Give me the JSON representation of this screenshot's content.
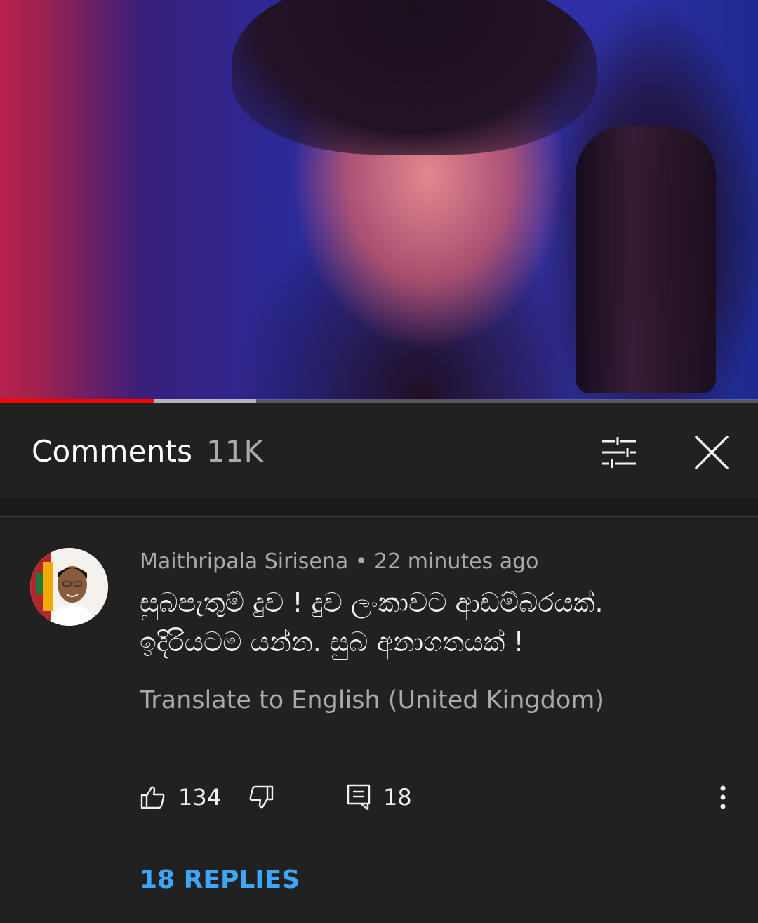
{
  "video": {
    "progress_played": 0.203,
    "progress_buffered": 0.338,
    "colors": {
      "played": "#ff0000",
      "background": "#212121"
    }
  },
  "comments_header": {
    "title": "Comments",
    "count": "11K",
    "sort_icon": "sort-filter-icon",
    "close_icon": "close-icon"
  },
  "comment": {
    "author": "Maithripala Sirisena",
    "separator": " • ",
    "time": "22 minutes ago",
    "text_lines": [
      "සුබපැතුම් දුව ! දුව ලංකාවට ආඩම්බරයක්.",
      "ඉදිරියටම යන්න.  සුබ අනාගතයක් !"
    ],
    "translate_label": "Translate to English (United Kingdom)",
    "likes": "134",
    "replies_count": "18",
    "replies_label": "18 REPLIES",
    "accent_color": "#3ea6ff"
  }
}
